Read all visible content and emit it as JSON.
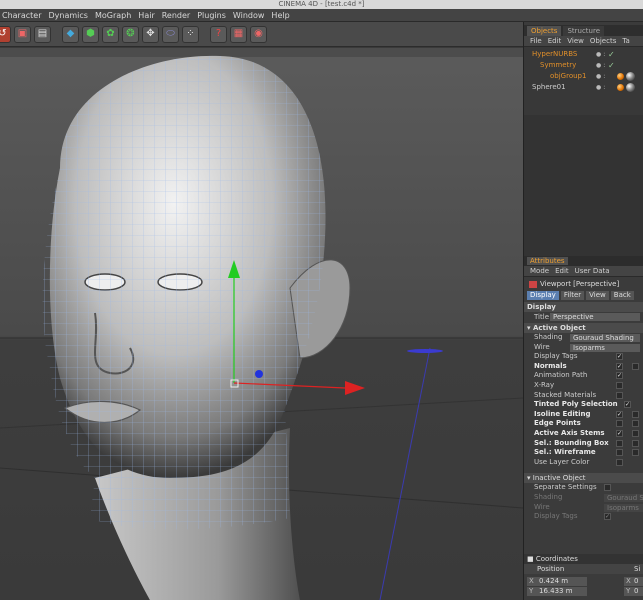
{
  "window": {
    "title": "CINEMA 4D - [test.c4d *]"
  },
  "menu": [
    "Character",
    "Dynamics",
    "MoGraph",
    "Hair",
    "Render",
    "Plugins",
    "Window",
    "Help"
  ],
  "toolbar_icons": [
    "undo-icon",
    "render-view-icon",
    "render-settings-icon",
    "cube-icon",
    "nurbs-icon",
    "array-icon",
    "spline-icon",
    "deformer-icon",
    "environment-icon",
    "camera-icon",
    "help-icon",
    "picture-viewer-icon",
    "render-icon"
  ],
  "objects_panel": {
    "tabs": [
      "Objects",
      "Structure"
    ],
    "menu": [
      "File",
      "Edit",
      "View",
      "Objects",
      "Ta"
    ],
    "objects": [
      {
        "name": "HyperNURBS",
        "color": "#e08f2a",
        "check": "✓"
      },
      {
        "name": "Symmetry",
        "color": "#e08f2a",
        "check": "✓"
      },
      {
        "name": "objGroup1",
        "color": "#e08f2a",
        "check": ""
      },
      {
        "name": "Sphere01",
        "color": "#cccccc",
        "check": ""
      }
    ]
  },
  "attributes_panel": {
    "tab": "Attributes",
    "menu": [
      "Mode",
      "Edit",
      "User Data"
    ],
    "viewport_label": "Viewport [Perspective]",
    "buttons": [
      "Display",
      "Filter",
      "View",
      "Back"
    ],
    "section_display": "Display",
    "title_label": "Title",
    "title_value": "Perspective",
    "active_object": {
      "header": "Active Object",
      "shading_label": "Shading",
      "shading_value": "Gouraud Shading",
      "wire_label": "Wire",
      "wire_value": "Isoparms",
      "rows": [
        {
          "label": "Display Tags",
          "bold": false,
          "checked": "✓"
        },
        {
          "label": "Normals",
          "bold": true,
          "checked": "✓"
        },
        {
          "label": "Animation Path",
          "bold": false,
          "checked": "✓"
        },
        {
          "label": "X-Ray",
          "bold": false,
          "checked": ""
        },
        {
          "label": "Stacked Materials",
          "bold": false,
          "checked": ""
        },
        {
          "label": "Tinted Poly Selection",
          "bold": true,
          "checked": "✓"
        },
        {
          "label": "Isoline Editing",
          "bold": true,
          "checked": "✓"
        },
        {
          "label": "Edge Points",
          "bold": true,
          "checked": ""
        },
        {
          "label": "Active Axis Stems",
          "bold": true,
          "checked": "✓"
        },
        {
          "label": "Sel.: Bounding Box",
          "bold": true,
          "checked": ""
        },
        {
          "label": "Sel.: Wireframe",
          "bold": true,
          "checked": ""
        },
        {
          "label": "Use Layer Color",
          "bold": false,
          "checked": ""
        }
      ]
    },
    "inactive_object": {
      "header": "Inactive Object",
      "separate_label": "Separate Settings",
      "shading_label": "Shading",
      "shading_value": "Gouraud S",
      "wire_label": "Wire",
      "wire_value": "Isoparms",
      "tags_label": "Display Tags",
      "tags_checked": "✓"
    }
  },
  "coordinates_panel": {
    "header": "Coordinates",
    "position_label": "Position",
    "size_label": "Si",
    "x_label": "X",
    "x_value": "0.424 m",
    "y_label": "Y",
    "y_value": "16.433 m",
    "sx_label": "X",
    "sx_value": "0",
    "sy_label": "Y",
    "sy_value": "0"
  }
}
